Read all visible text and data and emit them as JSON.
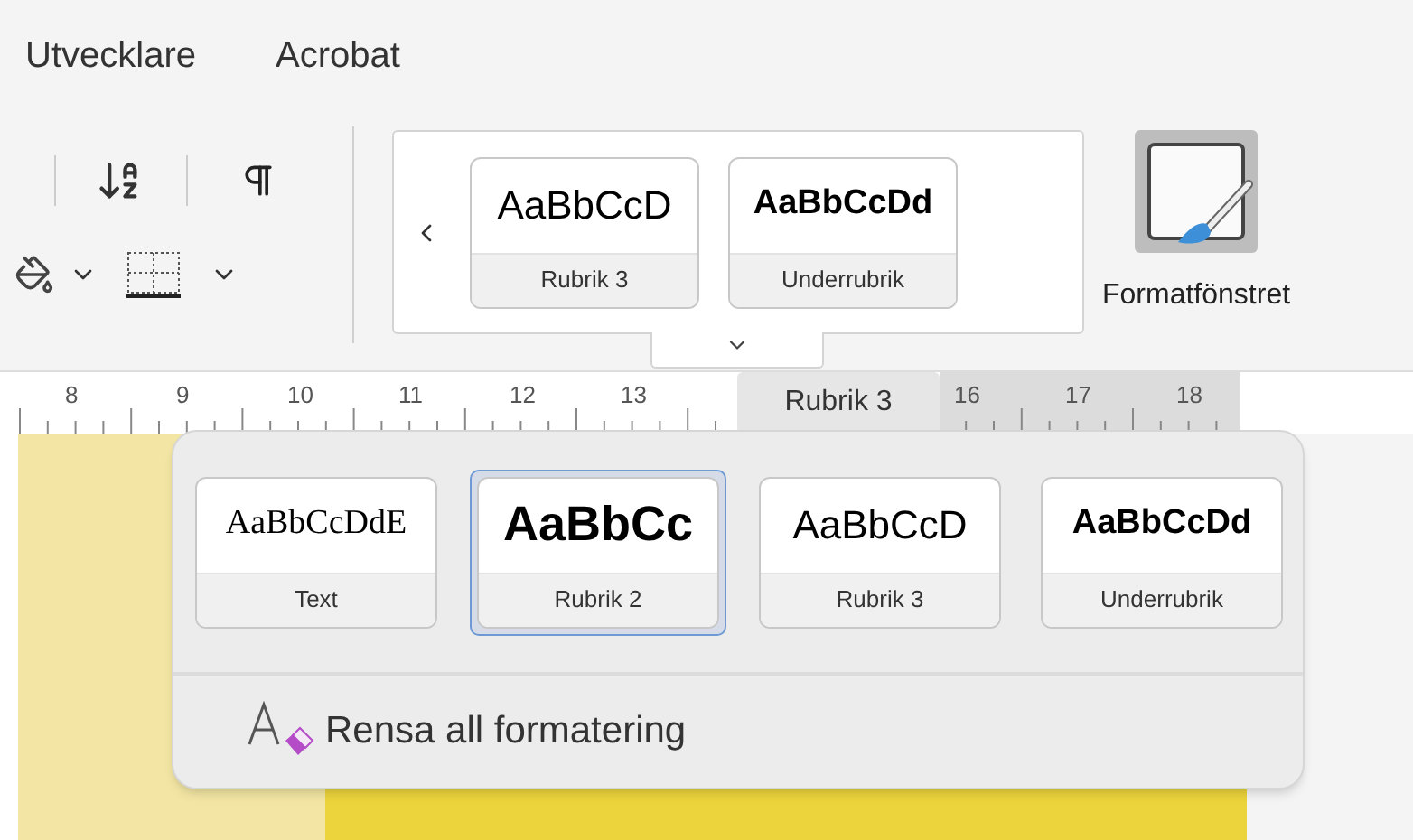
{
  "menu_tabs": [
    "Utvecklare",
    "Acrobat"
  ],
  "ribbon": {
    "style_gallery": [
      {
        "preview": "AaBbCcD",
        "label": "Rubrik 3",
        "kind": "plain"
      },
      {
        "preview": "AaBbCcDd",
        "label": "Underrubrik",
        "kind": "bold"
      }
    ],
    "styles_pane_button": "Formatfönstret"
  },
  "ruler": {
    "numbers": [
      "8",
      "9",
      "10",
      "11",
      "12",
      "13",
      "16",
      "17",
      "18"
    ]
  },
  "tooltip": "Rubrik 3",
  "style_popup": {
    "styles": [
      {
        "preview": "AaBbCcDdE",
        "label": "Text",
        "kind": "serif",
        "selected": false
      },
      {
        "preview": "AaBbCc",
        "label": "Rubrik 2",
        "kind": "heading",
        "selected": true
      },
      {
        "preview": "AaBbCcD",
        "label": "Rubrik 3",
        "kind": "plain",
        "selected": false
      },
      {
        "preview": "AaBbCcDd",
        "label": "Underrubrik",
        "kind": "bold",
        "selected": false
      }
    ],
    "clear_formatting": "Rensa all formatering"
  }
}
